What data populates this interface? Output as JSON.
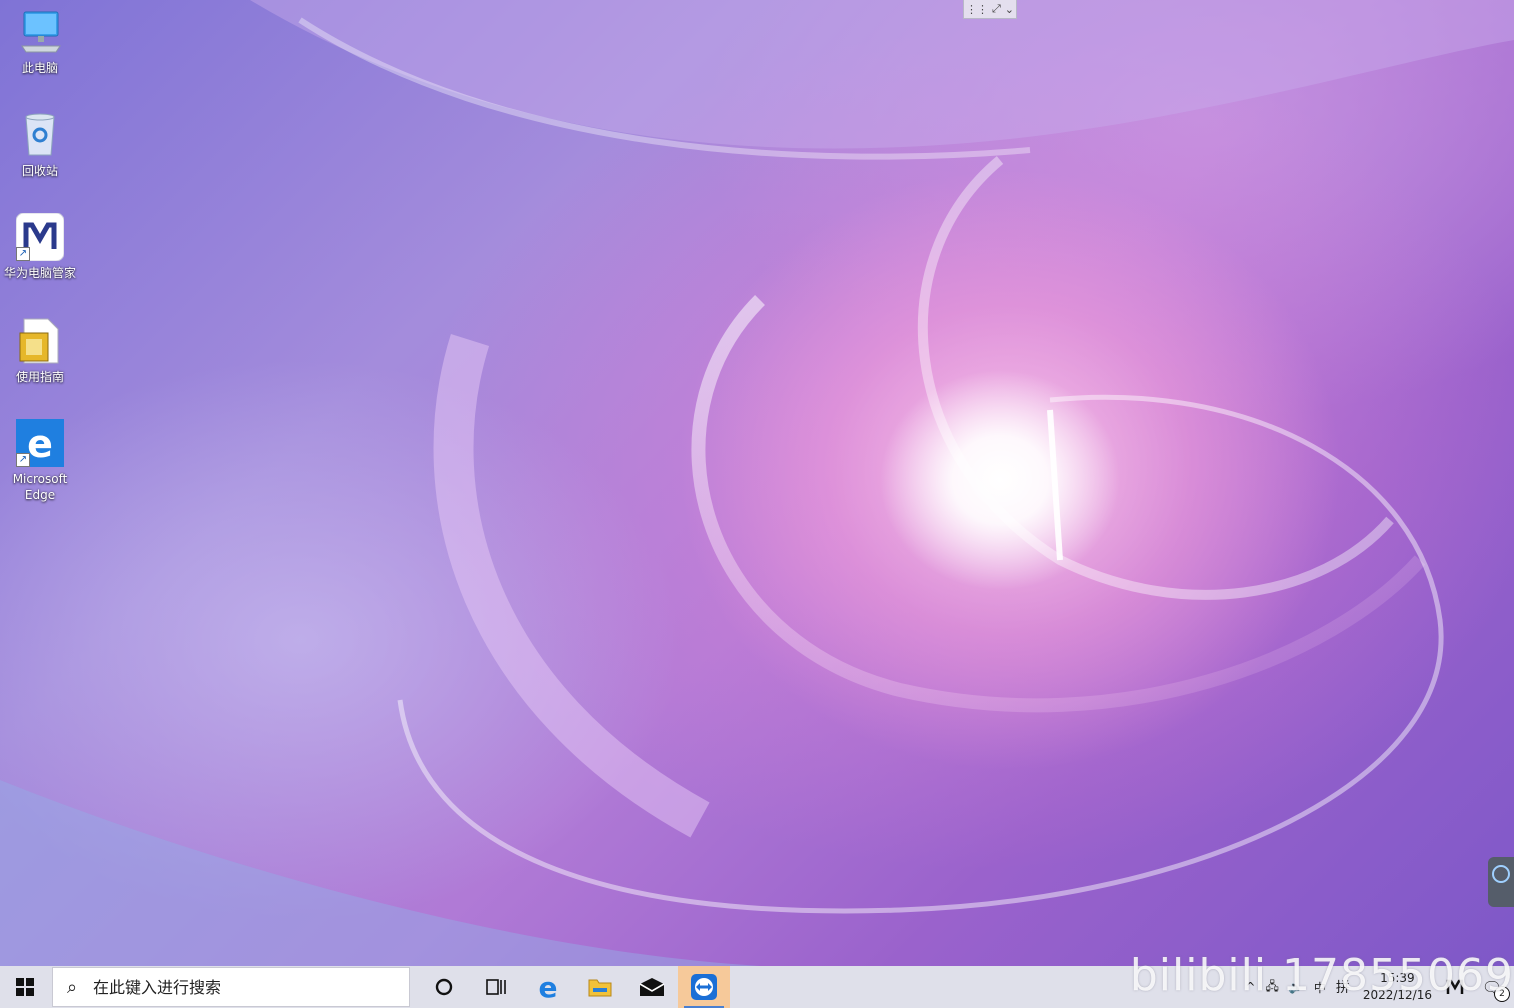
{
  "desktop": {
    "icons": [
      {
        "label": "此电脑",
        "icon": "computer-icon"
      },
      {
        "label": "回收站",
        "icon": "recycle-bin-icon"
      },
      {
        "label": "华为电脑管家",
        "icon": "huawei-pc-manager-icon"
      },
      {
        "label": "使用指南",
        "icon": "user-guide-icon"
      },
      {
        "label": "Microsoft Edge",
        "icon": "edge-icon"
      }
    ]
  },
  "taskbar": {
    "search_placeholder": "在此键入进行搜索",
    "pinned": [
      {
        "icon": "cortana-icon"
      },
      {
        "icon": "task-view-icon"
      },
      {
        "icon": "edge-icon"
      },
      {
        "icon": "file-explorer-icon"
      },
      {
        "icon": "mail-icon"
      },
      {
        "icon": "teamviewer-icon",
        "active": true
      }
    ],
    "tray": {
      "ime_label": "拼",
      "time": "15:39",
      "date": "2022/12/16",
      "notification_count": "2"
    }
  },
  "watermark": "bilibili 17855069",
  "colors": {
    "taskbar_bg": "#dfe0ea",
    "active_app": "#f6c99a"
  }
}
